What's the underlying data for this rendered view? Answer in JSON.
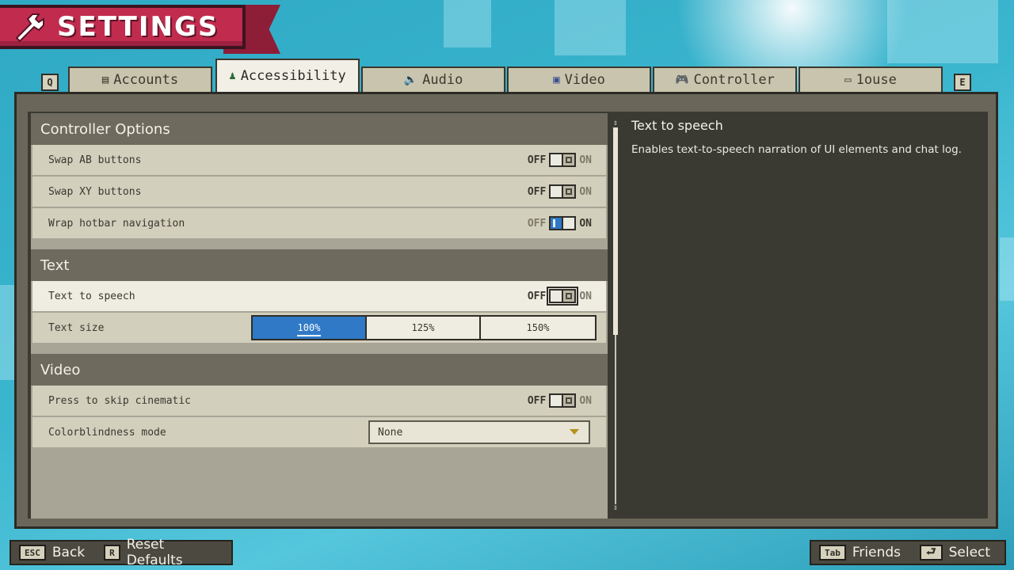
{
  "header": {
    "title": "SETTINGS",
    "icon": "wrench-icon"
  },
  "tabs": {
    "prev_key": "Q",
    "next_key": "E",
    "items": [
      {
        "label": "Accounts",
        "icon": "accounts-icon",
        "glyph": "▤"
      },
      {
        "label": "Accessibility",
        "icon": "accessibility-icon",
        "glyph": "♟"
      },
      {
        "label": "Audio",
        "icon": "speaker-icon",
        "glyph": "🔈"
      },
      {
        "label": "Video",
        "icon": "monitor-icon",
        "glyph": "▣"
      },
      {
        "label": "Controller",
        "icon": "gamepad-icon",
        "glyph": "🎮"
      },
      {
        "label": "1ouse",
        "icon": "mouse-icon",
        "glyph": "▭"
      }
    ],
    "active": "Accessibility"
  },
  "sections": {
    "controller": {
      "title": "Controller Options",
      "rows": [
        {
          "label": "Swap AB buttons",
          "value": "OFF"
        },
        {
          "label": "Swap XY buttons",
          "value": "OFF"
        },
        {
          "label": "Wrap hotbar navigation",
          "value": "ON"
        }
      ]
    },
    "text": {
      "title": "Text",
      "tts_label": "Text to speech",
      "tts_value": "OFF",
      "size_label": "Text size",
      "size_options": [
        "100%",
        "125%",
        "150%"
      ],
      "size_selected": "100%"
    },
    "video": {
      "title": "Video",
      "skip_label": "Press to skip cinematic",
      "skip_value": "OFF",
      "colorblind_label": "Colorblindness mode",
      "colorblind_value": "None"
    }
  },
  "toggle_labels": {
    "off": "OFF",
    "on": "ON"
  },
  "description": {
    "title": "Text to speech",
    "text": "Enables text-to-speech narration of UI elements and chat log."
  },
  "footer": {
    "back_key": "ESC",
    "back_label": "Back",
    "reset_key": "R",
    "reset_label": "Reset Defaults",
    "friends_key": "Tab",
    "friends_label": "Friends",
    "select_key": "⮐",
    "select_label": "Select"
  },
  "colors": {
    "accent": "#2f79c7",
    "banner": "#c12c4e",
    "panel": "#3b3a32"
  }
}
